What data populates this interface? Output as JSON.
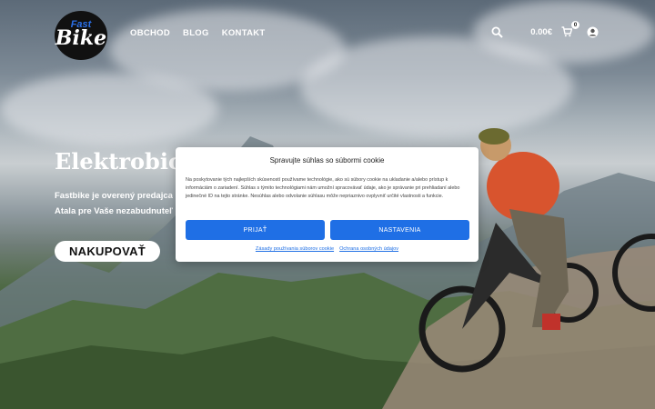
{
  "brand": {
    "top": "Fast",
    "bottom": "Bike"
  },
  "nav": {
    "items": [
      "OBCHOD",
      "BLOG",
      "KONTAKT"
    ]
  },
  "header": {
    "price": "0.00€",
    "cart_count": "0"
  },
  "hero": {
    "title": "Elektrobicykl",
    "line1": "Fastbike je overený predajca",
    "line2": "Atala pre Vaše nezabudnuteľ",
    "button": "NAKUPOVAŤ"
  },
  "cookie": {
    "title": "Spravujte súhlas so súbormi cookie",
    "text": "Na poskytovanie tých najlepších skúseností používame technológie, ako sú súbory cookie na ukladanie a/alebo prístup k informáciám o zariadení. Súhlas s týmito technológiami nám umožní spracovávať údaje, ako je správanie pri prehliadaní alebo jedinečné ID na tejto stránke. Nesúhlas alebo odvolanie súhlasu môže nepriaznivo ovplyvniť určité vlastnosti a funkcie.",
    "accept": "PRIJAŤ",
    "settings": "NASTAVENIA",
    "link1": "Zásady používania súborov cookie",
    "link2": "Ochrana osobných údajov"
  },
  "colors": {
    "accent": "#1f6fe5",
    "logo_bg": "#111111"
  },
  "icons": [
    "search-icon",
    "cart-icon",
    "account-icon"
  ]
}
